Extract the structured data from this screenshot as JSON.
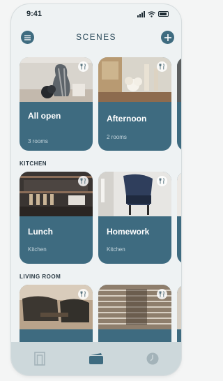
{
  "status_bar": {
    "time": "9:41"
  },
  "header": {
    "title": "SCENES"
  },
  "sections": [
    {
      "label": "KITCHEN"
    },
    {
      "label": "LIVING ROOM"
    }
  ],
  "cards": [
    {
      "title": "All open",
      "subtitle": "3 rooms"
    },
    {
      "title": "Afternoon",
      "subtitle": "2 rooms"
    },
    {
      "title": "Lunch",
      "subtitle": "Kitchen"
    },
    {
      "title": "Homework",
      "subtitle": "Kitchen"
    }
  ],
  "icons": {
    "menu": "menu-icon",
    "add": "plus-icon",
    "favorite": "utensils-icon",
    "tab_devices": "door-icon",
    "tab_scenes": "scenes-icon",
    "tab_schedule": "clock-icon"
  },
  "colors": {
    "accent": "#3e6b80",
    "background": "#eef2f3",
    "tab_bar": "#cdd8db"
  },
  "tab_bar": {
    "active_tab": "scenes"
  }
}
